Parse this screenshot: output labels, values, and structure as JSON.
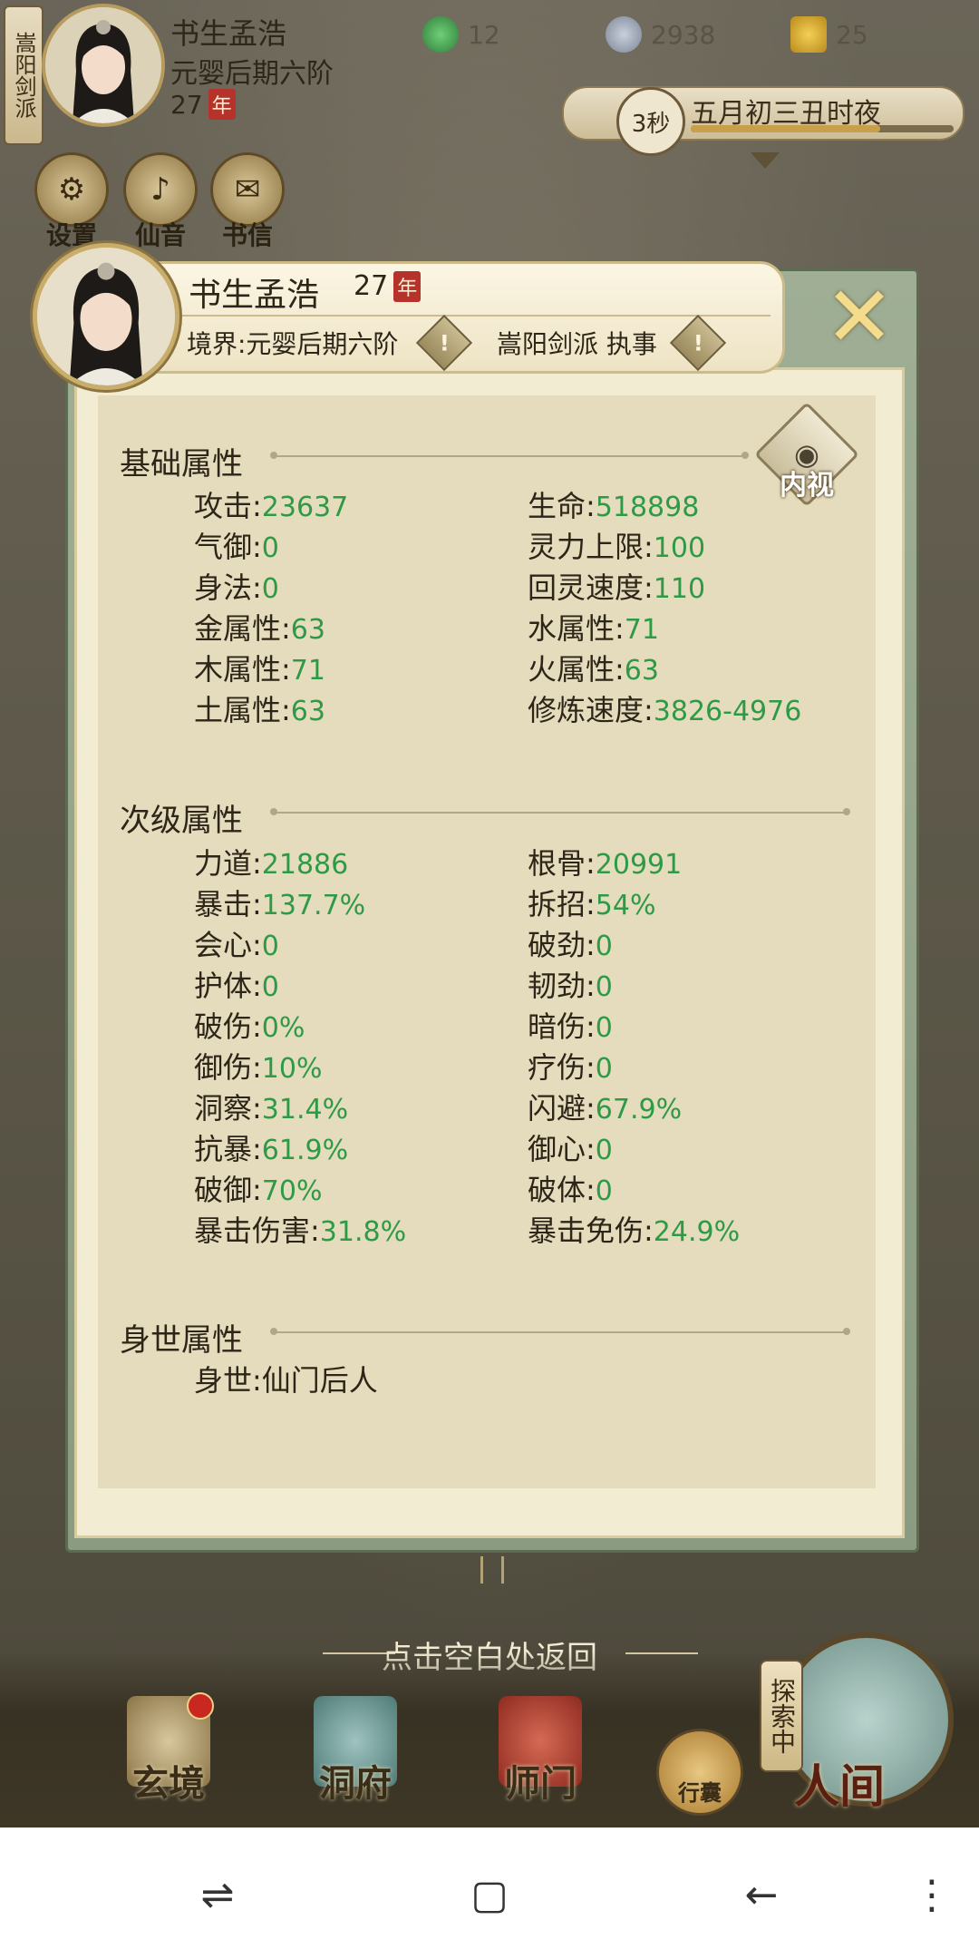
{
  "topbar": {
    "sect_banner": "嵩阳剑派",
    "name": "书生孟浩",
    "realm": "元婴后期六阶",
    "age": "27",
    "age_unit": "年",
    "currency_1": "12",
    "currency_2": "2938",
    "currency_3": "25",
    "timer": "3秒",
    "date": "五月初三丑时夜",
    "date_progress": 0.72
  },
  "quick_buttons": [
    {
      "label": "设置",
      "icon": "gear-icon"
    },
    {
      "label": "仙音",
      "icon": "music-icon"
    },
    {
      "label": "书信",
      "icon": "letter-icon"
    }
  ],
  "profile": {
    "name": "书生孟浩",
    "age": "27",
    "age_unit": "年",
    "realm": "境界:元婴后期六阶",
    "sect": "嵩阳剑派 执事"
  },
  "inner_view_label": "内视",
  "basic": {
    "title": "基础属性",
    "left": [
      {
        "label": "攻击:",
        "value": "23637"
      },
      {
        "label": "气御:",
        "value": "0"
      },
      {
        "label": "身法:",
        "value": "0"
      },
      {
        "label": "金属性:",
        "value": "63"
      },
      {
        "label": "木属性:",
        "value": "71"
      },
      {
        "label": "土属性:",
        "value": "63"
      }
    ],
    "right": [
      {
        "label": "生命:",
        "value": "518898"
      },
      {
        "label": "灵力上限:",
        "value": "100"
      },
      {
        "label": "回灵速度:",
        "value": "110"
      },
      {
        "label": "水属性:",
        "value": "71"
      },
      {
        "label": "火属性:",
        "value": "63"
      },
      {
        "label": "修炼速度:",
        "value": "3826-4976"
      }
    ]
  },
  "secondary": {
    "title": "次级属性",
    "left": [
      {
        "label": "力道:",
        "value": "21886"
      },
      {
        "label": "暴击:",
        "value": "137.7%"
      },
      {
        "label": "会心:",
        "value": "0"
      },
      {
        "label": "护体:",
        "value": "0"
      },
      {
        "label": "破伤:",
        "value": "0%"
      },
      {
        "label": "御伤:",
        "value": "10%"
      },
      {
        "label": "洞察:",
        "value": "31.4%"
      },
      {
        "label": "抗暴:",
        "value": "61.9%"
      },
      {
        "label": "破御:",
        "value": "70%"
      },
      {
        "label": "暴击伤害:",
        "value": "31.8%"
      }
    ],
    "right": [
      {
        "label": "根骨:",
        "value": "20991"
      },
      {
        "label": "拆招:",
        "value": "54%"
      },
      {
        "label": "破劲:",
        "value": "0"
      },
      {
        "label": "韧劲:",
        "value": "0"
      },
      {
        "label": "暗伤:",
        "value": "0"
      },
      {
        "label": "疗伤:",
        "value": "0"
      },
      {
        "label": "闪避:",
        "value": "67.9%"
      },
      {
        "label": "御心:",
        "value": "0"
      },
      {
        "label": "破体:",
        "value": "0"
      },
      {
        "label": "暴击免伤:",
        "value": "24.9%"
      }
    ]
  },
  "origin": {
    "title": "身世属性",
    "label": "身世:",
    "value": "仙门后人"
  },
  "hint": "点击空白处返回",
  "bottom_nav": {
    "items": [
      "玄境",
      "洞府",
      "师门"
    ],
    "bag": "行囊",
    "explore": "探索中",
    "world": "人间"
  },
  "colors": {
    "stat_value": "#2e9a46",
    "panel_green": "#8b9b81",
    "parchment": "#e5dcbe"
  }
}
